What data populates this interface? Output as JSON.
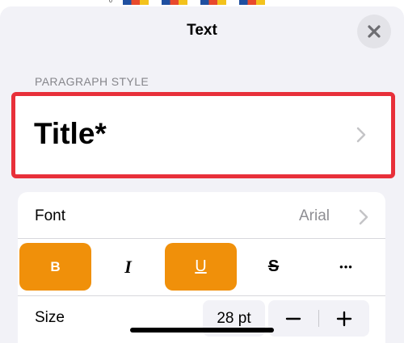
{
  "sheet": {
    "title": "Text"
  },
  "paragraph_style": {
    "header": "PARAGRAPH STYLE",
    "value": "Title*"
  },
  "font": {
    "label": "Font",
    "value": "Arial"
  },
  "style_buttons": [
    {
      "name": "bold",
      "label": "B",
      "active": true
    },
    {
      "name": "italic",
      "label": "I",
      "active": false
    },
    {
      "name": "underline",
      "label": "U",
      "active": true
    },
    {
      "name": "strikethrough",
      "label": "S",
      "active": false
    },
    {
      "name": "more",
      "label": "•••",
      "active": false
    }
  ],
  "size": {
    "label": "Size",
    "value": "28 pt",
    "decrement": "−",
    "increment": "+"
  },
  "colors": {
    "accent": "#f0900a",
    "highlight": "#e8303a",
    "sheet_bg": "#f2f2f7"
  },
  "icons": {
    "close": "close-icon",
    "chevron": "chevron-right-icon"
  }
}
